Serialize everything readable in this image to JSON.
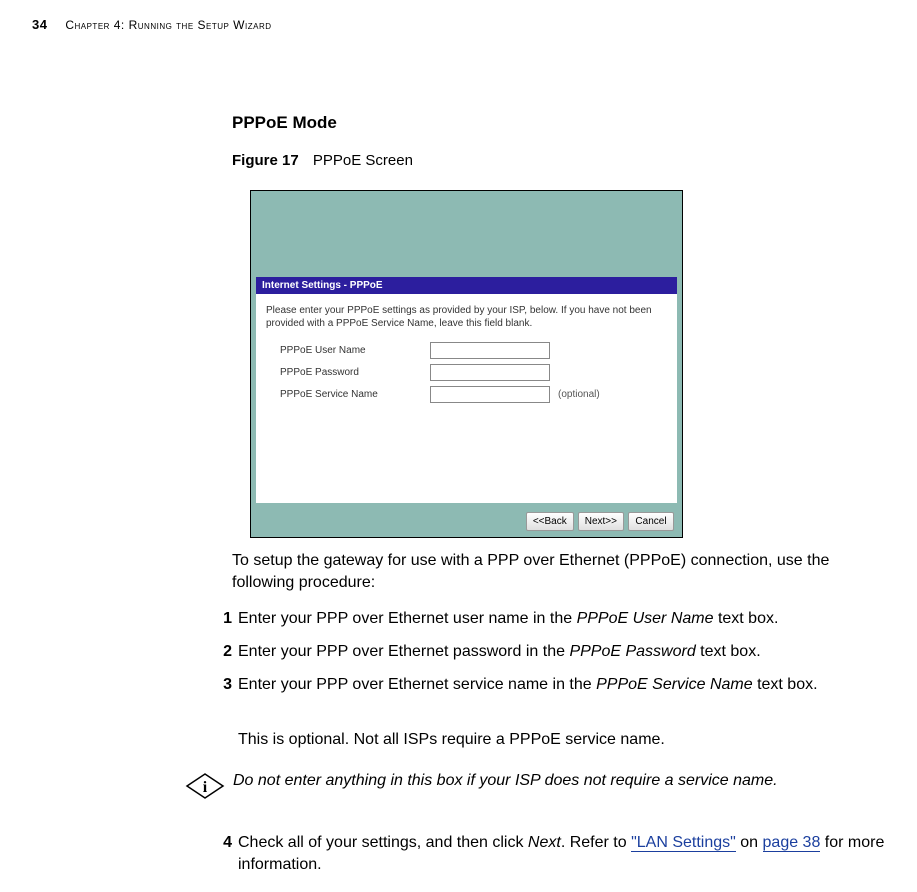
{
  "header": {
    "page_number": "34",
    "chapter": "Chapter 4: Running the Setup Wizard"
  },
  "section_title": "PPPoE Mode",
  "figure": {
    "label": "Figure 17",
    "caption": "PPPoE Screen"
  },
  "dialog": {
    "title": "Internet Settings - PPPoE",
    "instruction": "Please enter your PPPoE settings as provided by your ISP, below. If you have not been provided with a PPPoE Service Name, leave this field blank.",
    "rows": [
      {
        "label": "PPPoE User Name",
        "value": "",
        "optional": ""
      },
      {
        "label": "PPPoE Password",
        "value": "",
        "optional": ""
      },
      {
        "label": "PPPoE Service Name",
        "value": "",
        "optional": "(optional)"
      }
    ],
    "buttons": {
      "back": "<<Back",
      "next": "Next>>",
      "cancel": "Cancel"
    }
  },
  "intro": "To setup the gateway for use with a PPP over Ethernet (PPPoE) connection, use the following procedure:",
  "steps": {
    "n1": "1",
    "s1a": "Enter your PPP over Ethernet user name in the ",
    "s1i": "PPPoE User Name",
    "s1b": " text box.",
    "n2": "2",
    "s2a": "Enter your PPP over Ethernet password in the ",
    "s2i": "PPPoE Password",
    "s2b": " text box.",
    "n3": "3",
    "s3a": "Enter your PPP over Ethernet service name in the ",
    "s3i": "PPPoE Service Name",
    "s3b": " text box.",
    "after3": "This is optional. Not all ISPs require a PPPoE service name.",
    "note": "Do not enter anything in this box if your ISP does not require a service name.",
    "n4": "4",
    "s4a": "Check all of your settings, and then click ",
    "s4i": "Next",
    "s4b": ". Refer to ",
    "s4link": "\"LAN Settings\"",
    "s4c": " on ",
    "s4page": "page 38",
    "s4d": " for more information."
  }
}
